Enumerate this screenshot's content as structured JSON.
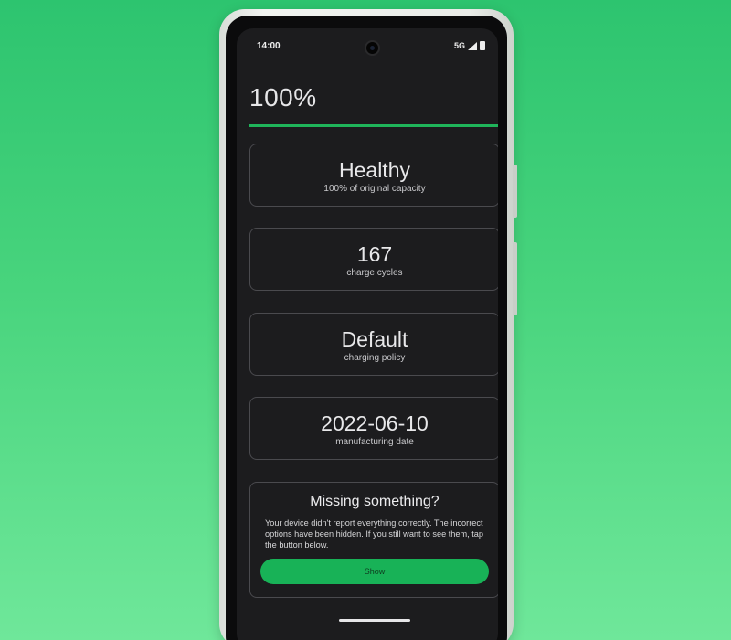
{
  "status_bar": {
    "time": "14:00",
    "network": "5G",
    "icons": [
      "signal-icon",
      "battery-icon"
    ]
  },
  "battery": {
    "level_text": "100%",
    "level_fraction": 1.0,
    "accent_color": "#1fb45a"
  },
  "cards": {
    "health": {
      "value": "Healthy",
      "label": "100% of original capacity"
    },
    "cycles": {
      "value": "167",
      "label": "charge cycles"
    },
    "policy": {
      "value": "Default",
      "label": "charging policy"
    },
    "manufacture": {
      "value": "2022-06-10",
      "label": "manufacturing date"
    }
  },
  "missing": {
    "title": "Missing something?",
    "text": "Your device didn't report everything correctly. The incorrect options have been hidden. If you still want to see them, tap the button below.",
    "button_label": "Show"
  }
}
